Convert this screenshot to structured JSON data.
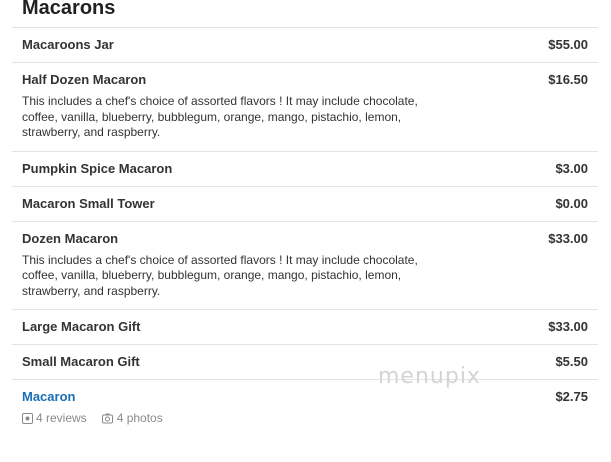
{
  "section": {
    "title": "Macarons"
  },
  "items": [
    {
      "name": "Macaroons Jar",
      "price": "$55.00"
    },
    {
      "name": "Half Dozen Macaron",
      "price": "$16.50",
      "description": "This includes a chef's choice of assorted flavors ! It may include chocolate, coffee, vanilla, blueberry, bubblegum, orange, mango, pistachio, lemon, strawberry, and raspberry."
    },
    {
      "name": "Pumpkin Spice Macaron",
      "price": "$3.00"
    },
    {
      "name": "Macaron Small Tower",
      "price": "$0.00"
    },
    {
      "name": "Dozen Macaron",
      "price": "$33.00",
      "description": "This includes a chef's choice of assorted flavors ! It may include chocolate, coffee, vanilla, blueberry, bubblegum, orange, mango, pistachio, lemon, strawberry, and raspberry."
    },
    {
      "name": "Large Macaron Gift",
      "price": "$33.00"
    },
    {
      "name": "Small Macaron Gift",
      "price": "$5.50"
    },
    {
      "name": "Macaron",
      "price": "$2.75",
      "reviews": "4 reviews",
      "photos": "4 photos"
    }
  ],
  "icons": {
    "reviews": "review-icon",
    "photos": "camera-icon"
  },
  "colors": {
    "link": "#1a6fb5",
    "meta": "#8a8a8a",
    "divider": "#e4e4e4"
  },
  "watermark": "menupix"
}
